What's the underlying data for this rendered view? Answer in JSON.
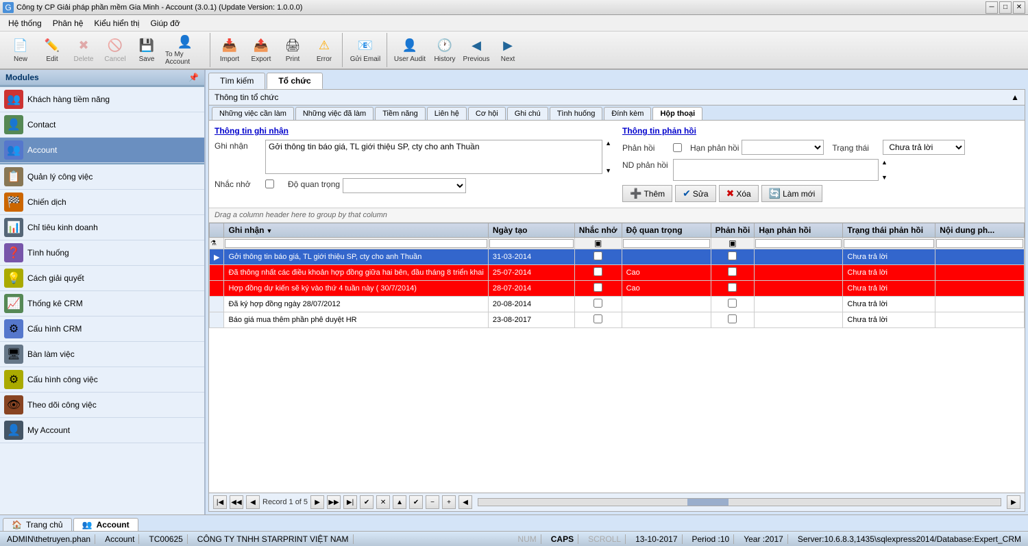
{
  "titleBar": {
    "text": "Công ty CP Giải pháp phần mềm Gia Minh - Account (3.0.1) (Update Version: 1.0.0.0)"
  },
  "menuBar": {
    "items": [
      "Hệ thống",
      "Phân hệ",
      "Kiểu hiển thị",
      "Giúp đỡ"
    ]
  },
  "toolbar": {
    "groups": [
      {
        "buttons": [
          {
            "label": "New",
            "icon": "📄",
            "name": "new-button"
          },
          {
            "label": "Edit",
            "icon": "✏️",
            "name": "edit-button"
          },
          {
            "label": "Delete",
            "icon": "✖",
            "name": "delete-button",
            "disabled": true
          },
          {
            "label": "Cancel",
            "icon": "🚫",
            "name": "cancel-button",
            "disabled": true
          },
          {
            "label": "Save",
            "icon": "💾",
            "name": "save-button",
            "disabled": false
          },
          {
            "label": "To My Account",
            "icon": "👤",
            "name": "to-my-account-button"
          }
        ]
      },
      {
        "buttons": [
          {
            "label": "Import",
            "icon": "📥",
            "name": "import-button"
          },
          {
            "label": "Export",
            "icon": "📤",
            "name": "export-button"
          },
          {
            "label": "Print",
            "icon": "🖨",
            "name": "print-button"
          },
          {
            "label": "Error",
            "icon": "⚠",
            "name": "error-button"
          }
        ]
      },
      {
        "buttons": [
          {
            "label": "Gửi Email",
            "icon": "📧",
            "name": "send-email-button"
          }
        ]
      },
      {
        "buttons": [
          {
            "label": "User Audit",
            "icon": "👤",
            "name": "user-audit-button"
          },
          {
            "label": "History",
            "icon": "🕐",
            "name": "history-button"
          },
          {
            "label": "Previous",
            "icon": "◀",
            "name": "previous-button"
          },
          {
            "label": "Next",
            "icon": "▶",
            "name": "next-button"
          }
        ]
      }
    ]
  },
  "sidebar": {
    "title": "Modules",
    "items": [
      {
        "label": "Khách hàng tiềm năng",
        "icon": "👥",
        "color": "#cc3333",
        "active": false
      },
      {
        "label": "Contact",
        "icon": "👤",
        "color": "#558855",
        "active": false
      },
      {
        "label": "Account",
        "icon": "👥",
        "color": "#5577cc",
        "active": true
      },
      {
        "label": "Quản lý công việc",
        "icon": "📋",
        "color": "#887755",
        "active": false
      },
      {
        "label": "Chiến dịch",
        "icon": "🏁",
        "color": "#cc6600",
        "active": false
      },
      {
        "label": "Chỉ tiêu kinh doanh",
        "icon": "📊",
        "color": "#556677",
        "active": false
      },
      {
        "label": "Tình huống",
        "icon": "❓",
        "color": "#7755aa",
        "active": false
      },
      {
        "label": "Cách giải quyết",
        "icon": "💡",
        "color": "#aaaa00",
        "active": false
      },
      {
        "label": "Thống kê CRM",
        "icon": "📈",
        "color": "#558855",
        "active": false
      },
      {
        "label": "Cấu hình CRM",
        "icon": "⚙",
        "color": "#5577cc",
        "active": false
      },
      {
        "label": "Bàn làm việc",
        "icon": "🖥",
        "color": "#667788",
        "active": false
      },
      {
        "label": "Cấu hình công việc",
        "icon": "⚙",
        "color": "#aaaa00",
        "active": false
      },
      {
        "label": "Theo dõi công việc",
        "icon": "👁",
        "color": "#884422",
        "active": false
      },
      {
        "label": "My Account",
        "icon": "👤",
        "color": "#445566",
        "active": false
      }
    ]
  },
  "mainTabs": [
    {
      "label": "Tìm kiếm",
      "active": false
    },
    {
      "label": "Tổ chức",
      "active": true
    }
  ],
  "panelTitle": "Thông tin tổ chức",
  "subTabs": [
    {
      "label": "Những việc cần làm",
      "active": false
    },
    {
      "label": "Những việc đã làm",
      "active": false
    },
    {
      "label": "Tiềm năng",
      "active": false
    },
    {
      "label": "Liên hệ",
      "active": false
    },
    {
      "label": "Cơ hội",
      "active": false
    },
    {
      "label": "Ghi chú",
      "active": false
    },
    {
      "label": "Tình huống",
      "active": false
    },
    {
      "label": "Đính kèm",
      "active": false
    },
    {
      "label": "Hộp thoại",
      "active": true
    }
  ],
  "formLeft": {
    "sectionTitle": "Thông tin ghi nhận",
    "ghiNhanLabel": "Ghi nhận",
    "ghiNhanValue": "Gởi thông tin báo giá, TL giới thiệu SP, cty cho anh Thuần",
    "nhacNhoLabel": "Nhắc nhở",
    "doQuanTrongLabel": "Độ quan trọng",
    "doQuanTrongValue": ""
  },
  "formRight": {
    "sectionTitle": "Thông tin phản hồi",
    "phanHoiLabel": "Phản hồi",
    "hanPhanHoiLabel": "Hạn phản hồi",
    "trangThaiLabel": "Trạng thái",
    "trangThaiValue": "Chưa trả lời",
    "ndPhanHoiLabel": "ND phản hồi",
    "ndPhanHoiValue": ""
  },
  "actionButtons": [
    {
      "label": "Thêm",
      "icon": "➕",
      "name": "them-button",
      "color": "green"
    },
    {
      "label": "Sửa",
      "icon": "✔",
      "name": "sua-button",
      "color": "blue"
    },
    {
      "label": "Xóa",
      "icon": "✖",
      "name": "xoa-button",
      "color": "red"
    },
    {
      "label": "Làm mới",
      "icon": "🔄",
      "name": "lam-moi-button",
      "color": "teal"
    }
  ],
  "gridDragHint": "Drag a column header here to group by that column",
  "gridColumns": [
    {
      "label": "Ghi nhận",
      "name": "ghi-nhan-col"
    },
    {
      "label": "Ngày tạo",
      "name": "ngay-tao-col"
    },
    {
      "label": "Nhắc nhở",
      "name": "nhac-nho-col"
    },
    {
      "label": "Độ quan trọng",
      "name": "do-quan-trong-col"
    },
    {
      "label": "Phản hồi",
      "name": "phan-hoi-col"
    },
    {
      "label": "Hạn phản hồi",
      "name": "han-phan-hoi-col"
    },
    {
      "label": "Trạng thái phản hồi",
      "name": "trang-thai-phan-hoi-col"
    },
    {
      "label": "Nội dung ph...",
      "name": "noi-dung-col"
    }
  ],
  "gridRows": [
    {
      "selected": true,
      "arrow": true,
      "ghiNhan": "Gởi thông tin báo giá, TL giới thiệu SP, cty cho anh Thuần",
      "ngayTao": "31-03-2014",
      "nhacNho": false,
      "doQuanTrong": "",
      "phanHoi": false,
      "hanPhanHoi": "",
      "trangThai": "Chưa trả lời",
      "noiDung": "",
      "rowClass": "row-selected"
    },
    {
      "selected": false,
      "arrow": false,
      "ghiNhan": "Đã thông nhất các điều khoản hợp đồng giữa hai bên, đầu tháng 8 triển khai",
      "ngayTao": "25-07-2014",
      "nhacNho": false,
      "doQuanTrong": "Cao",
      "phanHoi": false,
      "hanPhanHoi": "",
      "trangThai": "Chưa trả lời",
      "noiDung": "",
      "rowClass": "row-red"
    },
    {
      "selected": false,
      "arrow": false,
      "ghiNhan": "Hợp đồng dự kiến sẽ ký vào thứ 4 tuần này ( 30/7/2014)",
      "ngayTao": "28-07-2014",
      "nhacNho": false,
      "doQuanTrong": "Cao",
      "phanHoi": false,
      "hanPhanHoi": "",
      "trangThai": "Chưa trả lời",
      "noiDung": "",
      "rowClass": "row-red"
    },
    {
      "selected": false,
      "arrow": false,
      "ghiNhan": "Đã ký hợp đồng ngày 28/07/2012",
      "ngayTao": "20-08-2014",
      "nhacNho": false,
      "doQuanTrong": "",
      "phanHoi": false,
      "hanPhanHoi": "",
      "trangThai": "Chưa trả lời",
      "noiDung": "",
      "rowClass": "row-normal"
    },
    {
      "selected": false,
      "arrow": false,
      "ghiNhan": "Báo giá mua thêm phần phê duyệt HR",
      "ngayTao": "23-08-2017",
      "nhacNho": false,
      "doQuanTrong": "",
      "phanHoi": false,
      "hanPhanHoi": "",
      "trangThai": "Chưa trả lời",
      "noiDung": "",
      "rowClass": "row-normal"
    }
  ],
  "recordNav": {
    "recordInfo": "Record 1 of 5"
  },
  "bottomTabs": [
    {
      "label": "Trang chủ",
      "active": false,
      "icon": "🏠"
    },
    {
      "label": "Account",
      "active": true,
      "icon": "👥"
    }
  ],
  "statusBar": {
    "user": "ADMIN\\thetruyen.phan",
    "module": "Account",
    "code": "TC00625",
    "company": "CÔNG TY TNHH STARPRINT VIỆT NAM",
    "num": "NUM",
    "caps": "CAPS",
    "scroll": "SCROLL",
    "date": "13-10-2017",
    "period": "Period :10",
    "year": "Year :2017",
    "server": "Server:10.6.8.3,1435\\sqlexpress2014/Database:Expert_CRM"
  }
}
